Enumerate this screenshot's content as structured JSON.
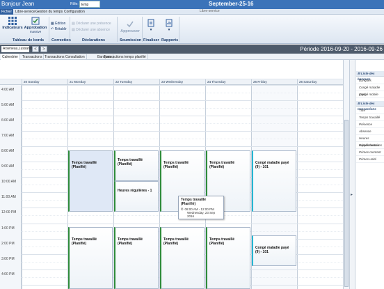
{
  "titlebar": {
    "user": "Bonjour Jean",
    "role_label": "Rôle:",
    "role_value": "Emp",
    "date": "September-25-16"
  },
  "menu": {
    "tabs": [
      "Fichier",
      "Libre-service",
      "Gestion du temps",
      "Configuration"
    ],
    "active": 0,
    "subtitle": "Libre-service"
  },
  "ribbon": {
    "indicateurs": "Indicateurs",
    "approbation": "Approbation",
    "approbation_sub": "massive",
    "group_tableau": "Tableau de bords",
    "edition": "Édition",
    "retablir": "Rétablir",
    "group_correction": "Correction",
    "declarer_presence": "Déclarer une présence",
    "declarer_absence": "Déclarer une absence",
    "group_declarations": "Déclarations",
    "approuver": "Approuver",
    "group_soumission": "Soumission",
    "finaliser": "Finaliser",
    "rapports": "Rapports"
  },
  "employee": {
    "name": "Arseneau,Lussandre",
    "prev": "<",
    "next": ">",
    "period": "Période 2016-09-20 - 2016-09-26"
  },
  "views": {
    "tabs": [
      "Calendrier",
      "Transactions",
      "Transactions Consultation",
      "Banques",
      "Transactions temps planifié"
    ],
    "active": 0
  },
  "calendar": {
    "days": [
      "20 Sunday",
      "21 Monday",
      "22 Tuesday",
      "23 Wednesday",
      "24 Thursday",
      "25 Friday",
      "26 Saturday"
    ],
    "hours": [
      "4:00 AM",
      "5:00 AM",
      "6:00 AM",
      "7:00 AM",
      "8:00 AM",
      "9:00 AM",
      "10:00 AM",
      "11:00 AM",
      "12:00 PM",
      "1:00 PM",
      "2:00 PM",
      "3:00 PM",
      "4:00 PM"
    ],
    "event_work": "Temps travaillé (Planifié)",
    "event_regular": "Heures régulières - 1",
    "event_sick": "Congé maladie payé (9) - 101"
  },
  "tooltip": {
    "title": "Temps travaillé (Planifié)",
    "time": "08:00 AM - 12:00 PM",
    "date": "Wednesday, 23 Sep 2016"
  },
  "right_panel": {
    "section1": "Liste des banques",
    "banks": [
      "Banques",
      "Congé maladie payé",
      "Congé mobile"
    ],
    "section2": "Liste des transactions",
    "transactions": [
      "Titre",
      "Temps travaillé",
      "Présence",
      "Absence",
      "Heures supplémentaires",
      "Primes heures",
      "Primes montant",
      "Primes unité"
    ]
  }
}
